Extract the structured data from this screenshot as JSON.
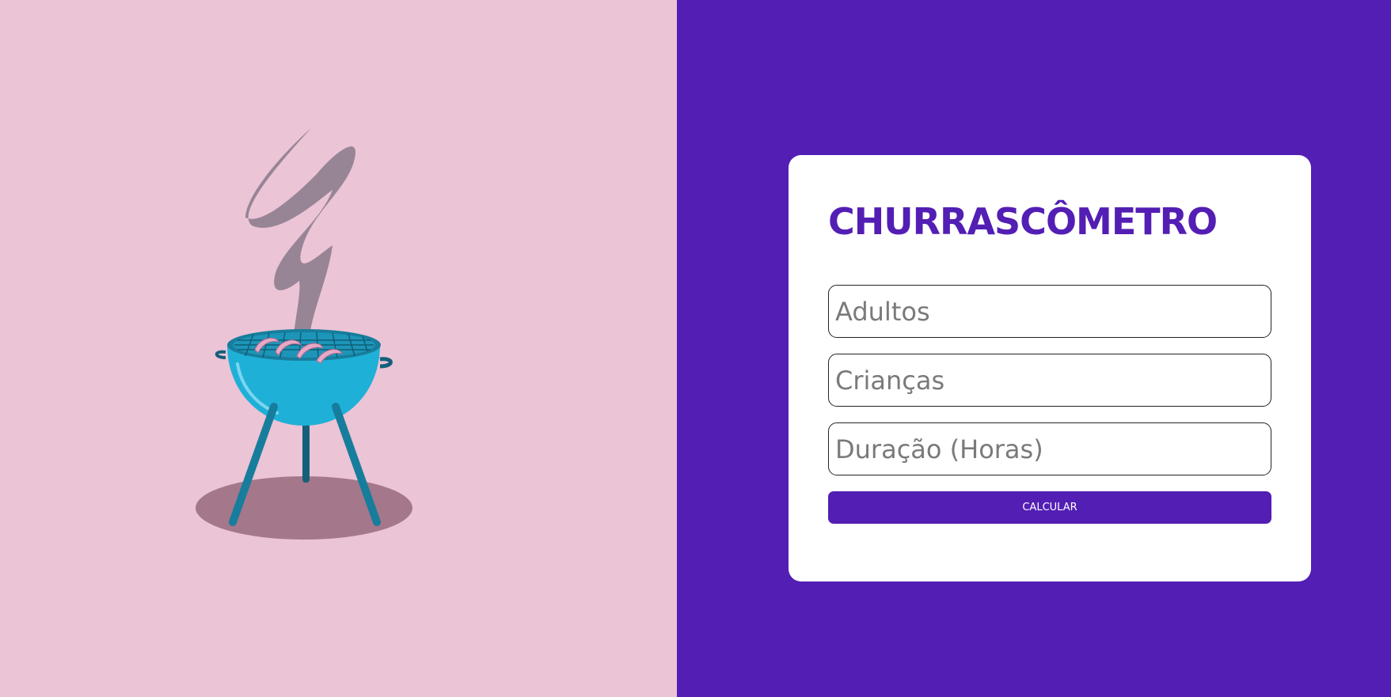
{
  "illustration": {
    "icon": "barbecue-grill-icon",
    "colors": {
      "background": "#ebc4d6",
      "grill_body": "#1fb0d8",
      "grill_dark": "#177d9c",
      "smoke": "#8e7e8f",
      "shadow": "#a5778a",
      "sausage": "#e6a9c6"
    }
  },
  "form": {
    "title": "CHURRASCÔMETRO",
    "adults_placeholder": "Adultos",
    "children_placeholder": "Crianças",
    "duration_placeholder": "Duração (Horas)",
    "calculate_label": "CALCULAR"
  },
  "theme": {
    "accent": "#531eb4",
    "card_background": "#ffffff"
  }
}
